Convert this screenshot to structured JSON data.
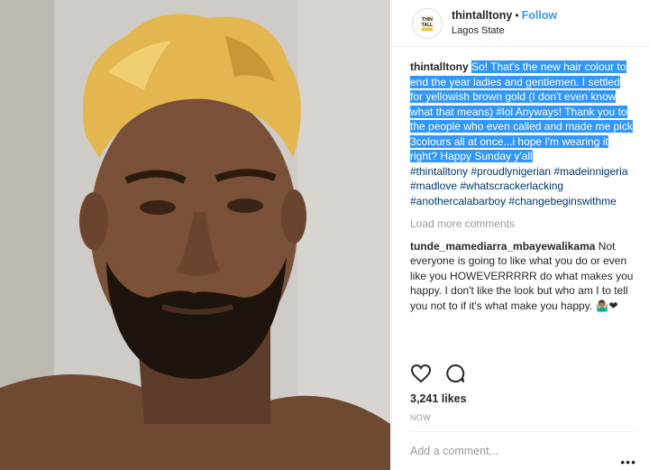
{
  "header": {
    "username": "thintalltony",
    "separator": "•",
    "follow_label": "Follow",
    "location": "Lagos State",
    "avatar_text": "THIN TALL TONY"
  },
  "caption": {
    "username": "thintalltony",
    "text": "So! That's the new hair colour to end the year ladies and gentlemen. I settled for yellowish brown gold (I don't even know what that means) #lol Anyways! Thank you to the people who even called and made me pick 3colours all at once...i hope I'm wearing it right? Happy Sunday y'all",
    "hashtags": "#thintalltony #proudlynigerian #madeinnigeria #madlove #whatscrackerlacking #anothercalabarboy #changebeginswithme"
  },
  "load_more": "Load more comments",
  "comment": {
    "username": "tunde_mamediarra_mbayewalikama",
    "text": "Not everyone is going to like what you do or even like you HOWEVERRRRR do what makes you happy. I don't like the look but who am I to tell you not to if it's what make you happy. 🤷🏽‍♂️❤"
  },
  "likes": "3,241 likes",
  "timestamp": "NOW",
  "add_comment_placeholder": "Add a comment...",
  "more_dots": "•••",
  "icons": [
    "heart-icon",
    "comment-icon",
    "more-options-icon"
  ],
  "colors": {
    "follow": "#3897f0",
    "highlight": "#3297fd",
    "hashtag": "#003569"
  }
}
